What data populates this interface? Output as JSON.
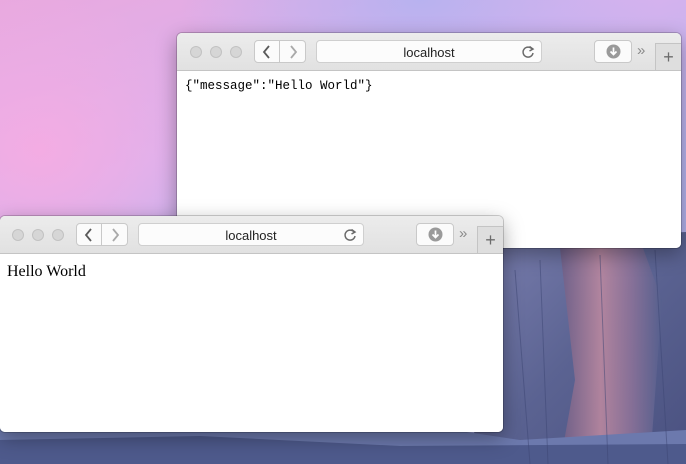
{
  "window_back": {
    "address": "localhost",
    "body_text": "{\"message\":\"Hello World\"}",
    "more_glyph": "»",
    "new_tab_glyph": "+"
  },
  "window_front": {
    "address": "localhost",
    "body_text": "Hello World",
    "more_glyph": "»",
    "new_tab_glyph": "+"
  },
  "icons": {
    "back": "chevron-left-icon",
    "forward": "chevron-right-icon",
    "reload": "reload-icon",
    "download": "download-icon"
  },
  "colors": {
    "toolbar": "#e5e5e5",
    "wallpaper_pink": "#e9a9df",
    "wallpaper_blue": "#9fa9e4",
    "rock": "#5d6a96"
  }
}
